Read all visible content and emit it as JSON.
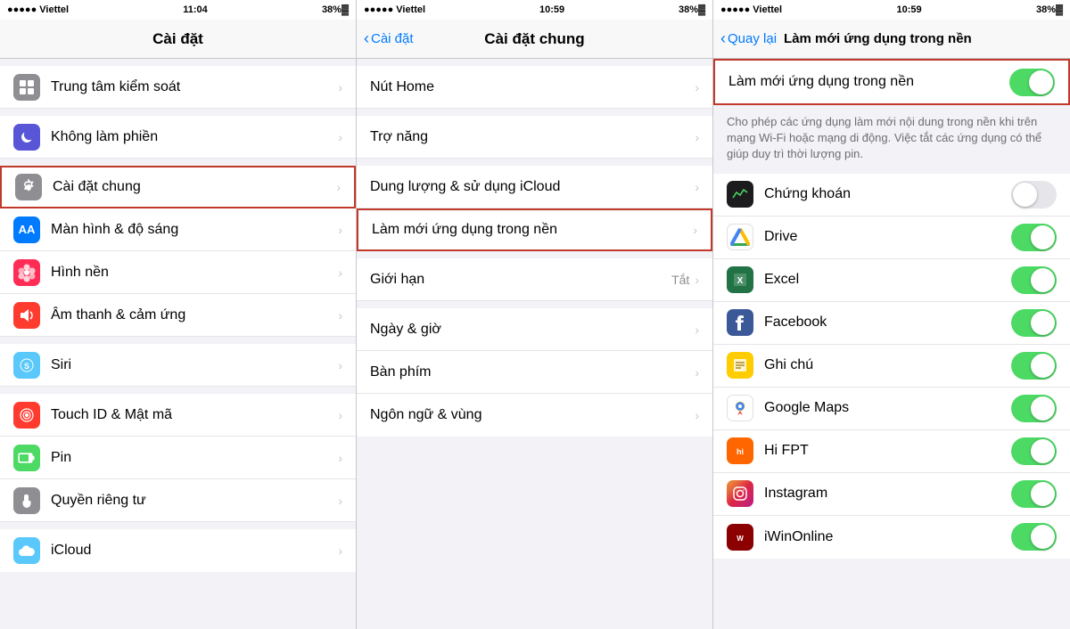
{
  "panels": [
    {
      "id": "panel1",
      "statusBar": {
        "signal": "●●●●● Viettel",
        "wifi": "▼",
        "time": "11:04",
        "indicator": "◼",
        "battery": "38%▓"
      },
      "navTitle": "Cài đặt",
      "navBack": null,
      "items": [
        {
          "id": "trung-tam-kiem-soat",
          "icon": "squares-icon",
          "iconBg": "#8e8e93",
          "label": "Trung tâm kiểm soát",
          "hasChevron": true,
          "highlighted": false
        },
        {
          "id": "khong-lam-phien",
          "icon": "moon-icon",
          "iconBg": "#5856d6",
          "label": "Không làm phiền",
          "hasChevron": true,
          "highlighted": false
        },
        {
          "id": "cai-dat-chung",
          "icon": "gear-icon",
          "iconBg": "#8e8e93",
          "label": "Cài đặt chung",
          "hasChevron": true,
          "highlighted": true
        },
        {
          "id": "man-hinh-do-sang",
          "icon": "aa-icon",
          "iconBg": "#007aff",
          "label": "Màn hình & độ sáng",
          "hasChevron": true,
          "highlighted": false
        },
        {
          "id": "hinh-nen",
          "icon": "flower-icon",
          "iconBg": "#ff2d55",
          "label": "Hình nền",
          "hasChevron": true,
          "highlighted": false
        },
        {
          "id": "am-thanh-cam-ung",
          "icon": "speaker-icon",
          "iconBg": "#ff3b30",
          "label": "Âm thanh & cảm ứng",
          "hasChevron": true,
          "highlighted": false
        },
        {
          "id": "siri",
          "icon": "siri-icon",
          "iconBg": "#5ac8fa",
          "label": "Siri",
          "hasChevron": true,
          "highlighted": false
        },
        {
          "id": "touch-id-mat-ma",
          "icon": "touchid-icon",
          "iconBg": "#ff3b30",
          "label": "Touch ID & Mật mã",
          "hasChevron": true,
          "highlighted": false
        },
        {
          "id": "pin",
          "icon": "battery-icon",
          "iconBg": "#4cd964",
          "label": "Pin",
          "hasChevron": true,
          "highlighted": false
        },
        {
          "id": "quyen-rieng-tu",
          "icon": "hand-icon",
          "iconBg": "#8e8e93",
          "label": "Quyền riêng tư",
          "hasChevron": true,
          "highlighted": false
        },
        {
          "id": "icloud",
          "icon": "cloud-icon",
          "iconBg": "#5ac8fa",
          "label": "iCloud",
          "hasChevron": true,
          "highlighted": false
        }
      ]
    },
    {
      "id": "panel2",
      "statusBar": {
        "signal": "●●●●● Viettel",
        "wifi": "▼",
        "time": "10:59",
        "indicator": "◼",
        "battery": "38%▓"
      },
      "navTitle": "Cài đặt chung",
      "navBack": "Cài đặt",
      "items": [
        {
          "id": "nut-home",
          "label": "Nút Home",
          "hasChevron": true,
          "highlighted": false
        },
        {
          "id": "tro-nang",
          "label": "Trợ năng",
          "hasChevron": true,
          "highlighted": false
        },
        {
          "id": "dung-luong-icloud",
          "label": "Dung lượng & sử dụng iCloud",
          "hasChevron": true,
          "highlighted": false
        },
        {
          "id": "lam-moi-ung-dung",
          "label": "Làm mới ứng dụng trong nền",
          "hasChevron": true,
          "highlighted": true
        },
        {
          "id": "gioi-han",
          "label": "Giới hạn",
          "hasChevron": true,
          "value": "Tắt",
          "highlighted": false
        },
        {
          "id": "ngay-gio",
          "label": "Ngày & giờ",
          "hasChevron": true,
          "highlighted": false
        },
        {
          "id": "ban-phim",
          "label": "Bàn phím",
          "hasChevron": true,
          "highlighted": false
        },
        {
          "id": "ngon-ngu-vung",
          "label": "Ngôn ngữ & vùng",
          "hasChevron": true,
          "highlighted": false
        }
      ]
    },
    {
      "id": "panel3",
      "statusBar": {
        "signal": "●●●●● Viettel",
        "wifi": "▼",
        "time": "10:59",
        "indicator": "◼",
        "battery": "38%▓"
      },
      "navTitle": "Làm mới ứng dụng trong nền",
      "navBack": "Quay lại",
      "mainToggle": {
        "label": "Làm mới ứng dụng trong nền",
        "isOn": true
      },
      "description": "Cho phép các ứng dụng làm mới nội dung trong nền khi trên mạng Wi-Fi hoặc mạng di động. Việc tắt các ứng dụng có thể giúp duy trì thời lượng pin.",
      "apps": [
        {
          "id": "chung-khoan",
          "label": "Chứng khoán",
          "isOn": false,
          "iconColor": "#1c1c1e"
        },
        {
          "id": "drive",
          "label": "Drive",
          "isOn": true,
          "iconColor": "#4caf50"
        },
        {
          "id": "excel",
          "label": "Excel",
          "isOn": true,
          "iconColor": "#217346"
        },
        {
          "id": "facebook",
          "label": "Facebook",
          "isOn": true,
          "iconColor": "#3b5998"
        },
        {
          "id": "ghi-chu",
          "label": "Ghi chú",
          "isOn": true,
          "iconColor": "#ffcc00"
        },
        {
          "id": "google-maps",
          "label": "Google Maps",
          "isOn": true,
          "iconColor": "#4285f4"
        },
        {
          "id": "hi-fpt",
          "label": "Hi FPT",
          "isOn": true,
          "iconColor": "#ff6600"
        },
        {
          "id": "instagram",
          "label": "Instagram",
          "isOn": true,
          "iconColor": "#c13584"
        },
        {
          "id": "iwinonline",
          "label": "iWinOnline",
          "isOn": true,
          "iconColor": "#8B0000"
        }
      ]
    }
  ],
  "icons": {
    "chevron_right": "›",
    "chevron_left": "‹",
    "battery_symbol": "🔋"
  }
}
